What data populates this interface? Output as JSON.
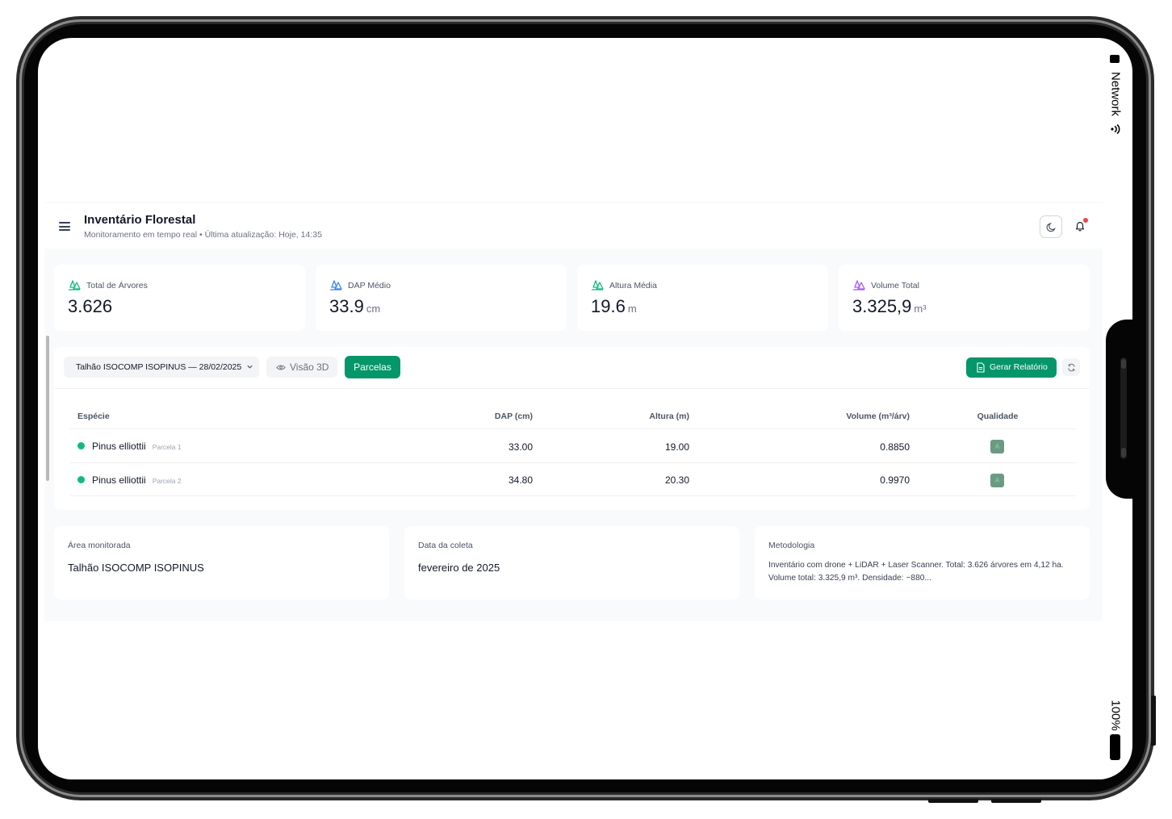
{
  "status_bar": {
    "network_label": "Network",
    "battery_label": "100%"
  },
  "header": {
    "title": "Inventário Florestal",
    "subtitle": "Monitoramento em tempo real • Última atualização: Hoje, 14:35"
  },
  "stats": [
    {
      "label": "Total de Árvores",
      "value": "3.626",
      "unit": "",
      "icon": "tree-icon",
      "color": "#10b981"
    },
    {
      "label": "DAP Médio",
      "value": "33.9",
      "unit": "cm",
      "icon": "tree-icon",
      "color": "#3b82f6"
    },
    {
      "label": "Altura Média",
      "value": "19.6",
      "unit": "m",
      "icon": "tree-icon",
      "color": "#10b981"
    },
    {
      "label": "Volume Total",
      "value": "3.325,9",
      "unit": "m³",
      "icon": "tree-icon",
      "color": "#a855f7"
    }
  ],
  "toolbar": {
    "plot_select": "Talhão ISOCOMP ISOPINUS — 28/02/2025",
    "view3d_label": "Visão 3D",
    "parcelas_label": "Parcelas",
    "report_label": "Gerar Relatório"
  },
  "table": {
    "headers": {
      "species": "Espécie",
      "dap": "DAP (cm)",
      "height": "Altura (m)",
      "volume": "Volume (m³/árv)",
      "quality": "Qualidade"
    },
    "rows": [
      {
        "species": "Pinus elliottii",
        "parcela": "Parcela 1",
        "dap": "33.00",
        "height": "19.00",
        "volume": "0.8850",
        "quality": "A"
      },
      {
        "species": "Pinus elliottii",
        "parcela": "Parcela 2",
        "dap": "34.80",
        "height": "20.30",
        "volume": "0.9970",
        "quality": "A"
      }
    ]
  },
  "info": {
    "area_label": "Área monitorada",
    "area_value": "Talhão ISOCOMP ISOPINUS",
    "date_label": "Data da coleta",
    "date_value": "fevereiro de 2025",
    "method_label": "Metodologia",
    "method_value": "Inventário com drone + LiDAR + Laser Scanner. Total: 3.626 árvores em 4,12 ha. Volume total: 3.325,9 m³. Densidade: ~880..."
  }
}
